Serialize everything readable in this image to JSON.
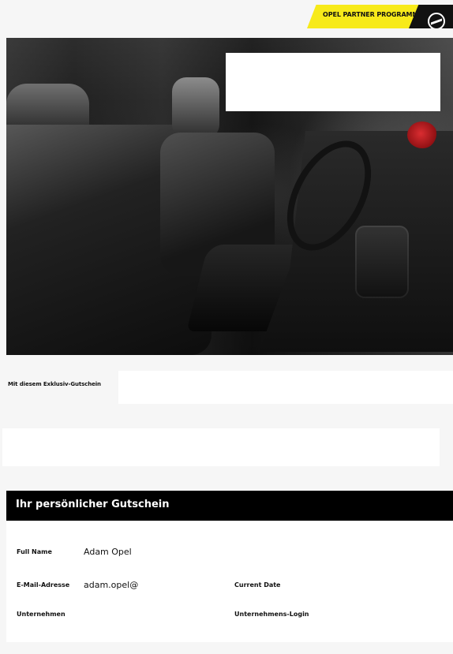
{
  "header": {
    "logo_text": "OPEL PARTNER PROGRAMM",
    "icon": "opel-emblem-icon",
    "colors": {
      "logo_yellow": "#f7ea1a",
      "logo_black": "#111111",
      "page_bg": "#f6f6f6",
      "panel_white": "#ffffff",
      "card_header": "#000000"
    }
  },
  "intro": {
    "text": "Mit diesem Exklusiv-Gutschein"
  },
  "voucher": {
    "title": "Ihr persönlicher Gutschein",
    "fields": {
      "full_name_label": "Full Name",
      "full_name_value": "Adam Opel",
      "email_label": "E-Mail-Adresse",
      "email_value": "adam.opel@",
      "current_date_label": "Current Date",
      "company_label": "Unternehmen",
      "company_login_label": "Unternehmens-Login"
    }
  }
}
